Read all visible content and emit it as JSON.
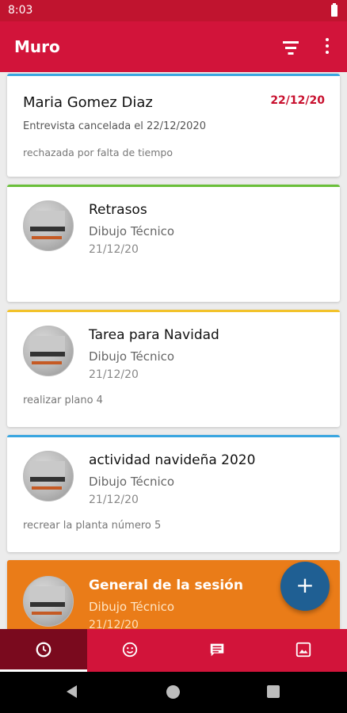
{
  "status_bar": {
    "time": "8:03"
  },
  "app_bar": {
    "title": "Muro"
  },
  "feed": {
    "interview": {
      "name": "Maria Gomez Diaz",
      "date": "22/12/20",
      "message": "Entrevista cancelada el 22/12/2020",
      "reason": "rechazada por falta de tiempo",
      "accent": "#3aa6e0"
    },
    "posts": [
      {
        "title": "Retrasos",
        "subject": "Dibujo Técnico",
        "date": "21/12/20",
        "description": "",
        "accent": "#6abf3a"
      },
      {
        "title": "Tarea para Navidad",
        "subject": "Dibujo Técnico",
        "date": "21/12/20",
        "description": "realizar plano 4",
        "accent": "#f2c22a"
      },
      {
        "title": "actividad navideña 2020",
        "subject": "Dibujo Técnico",
        "date": "21/12/20",
        "description": "recrear la planta número 5",
        "accent": "#3aa6e0"
      },
      {
        "title": "General de la sesión",
        "subject": "Dibujo Técnico",
        "date": "21/12/20",
        "description": "",
        "accent": "#ea7c18"
      }
    ]
  },
  "fab": {
    "label": "+"
  },
  "bottom_nav": [
    "clock-icon",
    "smiley-icon",
    "chat-icon",
    "image-icon"
  ],
  "colors": {
    "primary": "#d2143a",
    "status": "#c0142f",
    "active_tab": "#7a0a1e",
    "fab": "#1f5f93"
  }
}
